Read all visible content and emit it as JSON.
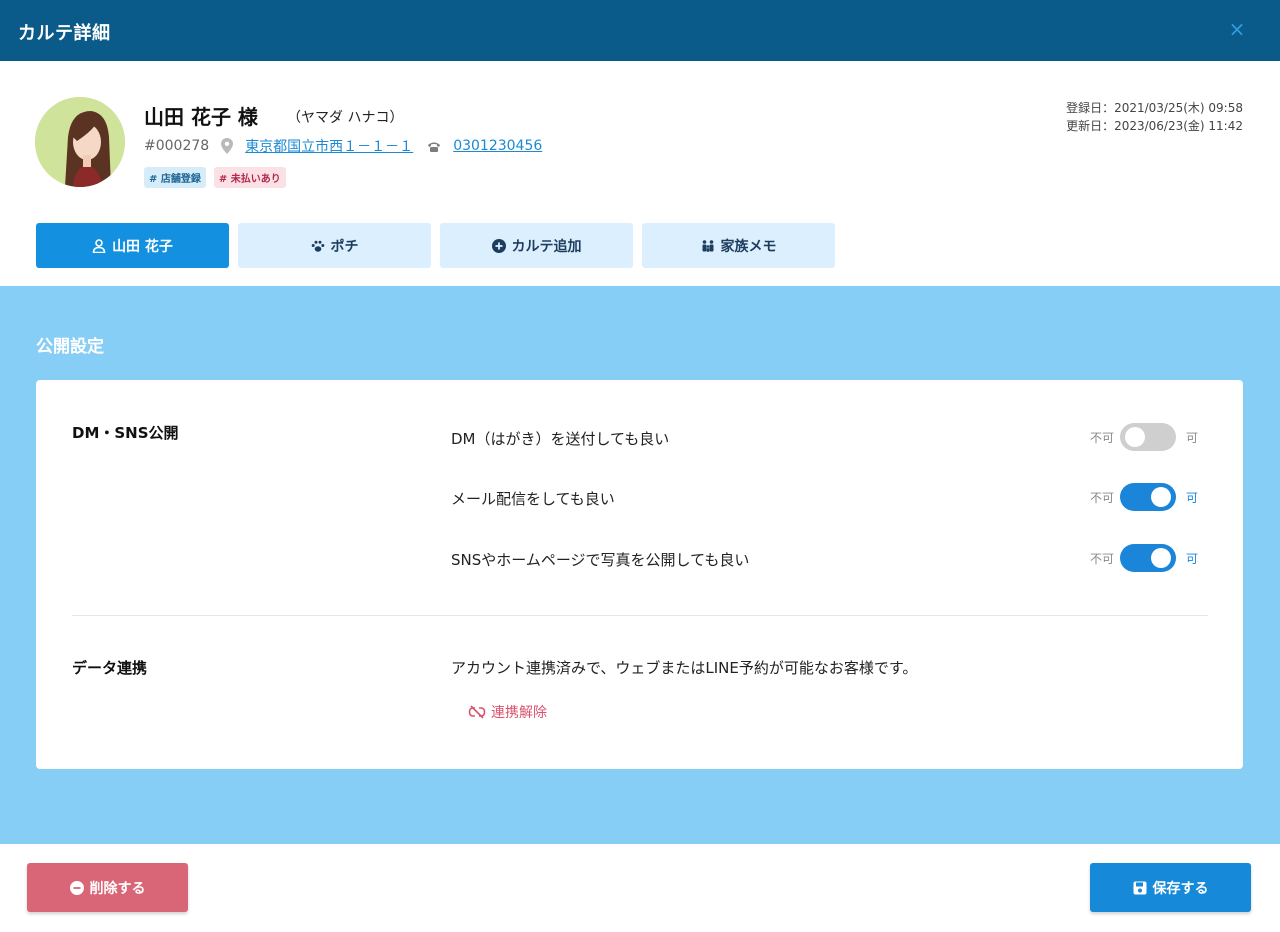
{
  "window": {
    "title": "カルテ詳細",
    "close": "×"
  },
  "customer": {
    "name": "山田 花子 様",
    "kana": "（ヤマダ ハナコ）",
    "id": "#000278",
    "address": "東京都国立市西１－１－１",
    "phone": "0301230456",
    "tags": [
      {
        "label": "# 店舗登録",
        "color": "#d7ecf9"
      },
      {
        "label": "# 未払いあり",
        "color": "#fbe0e5"
      }
    ]
  },
  "dates": {
    "registered": "登録日：2021/03/25(木) 09:58",
    "updated": "更新日：2023/06/23(金) 11:42"
  },
  "tabs": [
    {
      "label": "山田 花子",
      "icon": "user-icon",
      "active": true
    },
    {
      "label": "ポチ",
      "icon": "paw-icon",
      "active": false
    },
    {
      "label": "カルテ追加",
      "icon": "plus-circle-icon",
      "active": false
    },
    {
      "label": "家族メモ",
      "icon": "family-icon",
      "active": false
    }
  ],
  "panel": {
    "title": "公開設定",
    "dm_section": {
      "label": "DM・SNS公開",
      "options": [
        {
          "label": "DM（はがき）を送付しても良い",
          "off_label": "不可",
          "on_label": "可",
          "enabled": false
        },
        {
          "label": "メール配信をしても良い",
          "off_label": "不可",
          "on_label": "可",
          "enabled": true
        },
        {
          "label": "SNSやホームページで写真を公開しても良い",
          "off_label": "不可",
          "on_label": "可",
          "enabled": true
        }
      ]
    },
    "data_section": {
      "label": "データ連携",
      "text": "アカウント連携済みで、ウェブまたはLINE予約が可能なお客様です。",
      "unlink_label": "連携解除"
    }
  },
  "footer": {
    "delete_label": "削除する",
    "save_label": "保存する"
  },
  "colors": {
    "header": "#0a5a8a",
    "panel": "#87cef6",
    "accent": "#1490e0",
    "danger": "#d96677",
    "link": "#1a8ad4"
  }
}
